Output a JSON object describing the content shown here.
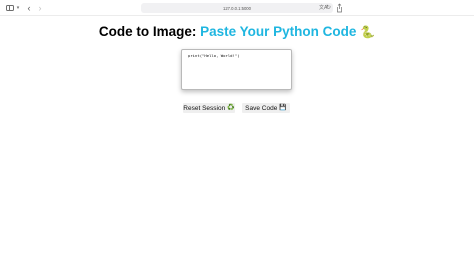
{
  "browser": {
    "address": "127.0.0.1:5000",
    "icons": {
      "sidebar": "sidebar-toggle-icon",
      "dropdown": "chevron-down-icon",
      "back": "back-arrow-icon",
      "forward": "forward-arrow-icon",
      "translate": "translate-icon",
      "reload": "reload-icon",
      "share": "share-icon"
    }
  },
  "page": {
    "title_prefix": "Code to Image: ",
    "title_accent": "Paste Your Python Code",
    "title_emoji": "🐍",
    "accent_color": "#1fb6e0",
    "code": "print(\"Hello, World!\")"
  },
  "buttons": {
    "reset_label": "Reset Session",
    "reset_icon": "♻️",
    "save_label": "Save Code",
    "save_icon": "💾"
  }
}
